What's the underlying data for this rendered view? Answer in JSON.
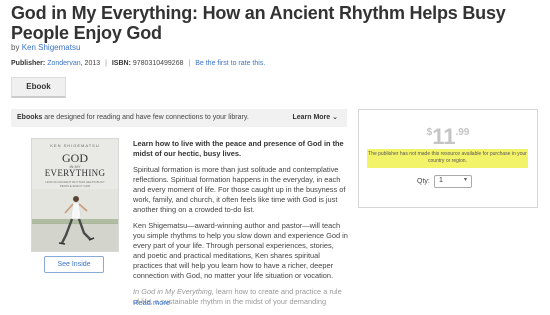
{
  "product": {
    "title": "God in My Everything: How an Ancient Rhythm Helps Busy People Enjoy God",
    "by_prefix": "by",
    "author": "Ken Shigematsu"
  },
  "meta": {
    "publisher_label": "Publisher:",
    "publisher": "Zondervan",
    "year": ", 2013",
    "isbn_label": "ISBN:",
    "isbn": "9780310499268",
    "rate_link": "Be the first to rate this."
  },
  "format_tab": {
    "label": "Ebook"
  },
  "infobar": {
    "bold": "Ebooks",
    "text": " are designed for reading and have few connections to your library.",
    "learn_more": "Learn More"
  },
  "cover": {
    "author": "KEN SHIGEMATSU",
    "word1": "GOD",
    "word2": "IN MY",
    "word3": "EVERYTHING",
    "subtitle": "HOW AN ANCIENT RHYTHM HELPS BUSY PEOPLE ENJOY GOD"
  },
  "see_inside": "See Inside",
  "description": {
    "lead": "Learn how to live with the peace and presence of God in the midst of our hectic, busy lives.",
    "p1": "Spiritual formation is more than just solitude and contemplative reflections. Spiritual formation happens in the everyday, in each and every moment of life.  For those caught up in the busyness of work, family, and church, it often feels like time with God is just another thing on a crowded to-do list.",
    "p2": "Ken Shigematsu—award-winning author and pastor—will teach you simple rhythms to help you slow down and experience God in every part of your life. Through personal experiences, stories, and poetic and practical meditations, Ken shares spiritual practices that will help you learn how to have a richer, deeper connection with God, no matter your life situation or vocation.",
    "p3_italic": "In God in My Everything,",
    "p3": " learn how to create and practice a rule of life, a sustainable rhythm in the midst of your demanding",
    "read_more": "Read more"
  },
  "purchase": {
    "currency": "$",
    "dollars": "11",
    "cents": ".99",
    "notice": "The publisher has not made this resource available for purchase in your country or region.",
    "qty_label": "Qty:",
    "qty_value": "1"
  },
  "colors": {
    "link": "#3b73c8",
    "notice_bg": "#f3f36a",
    "price": "#c4c4c4"
  }
}
